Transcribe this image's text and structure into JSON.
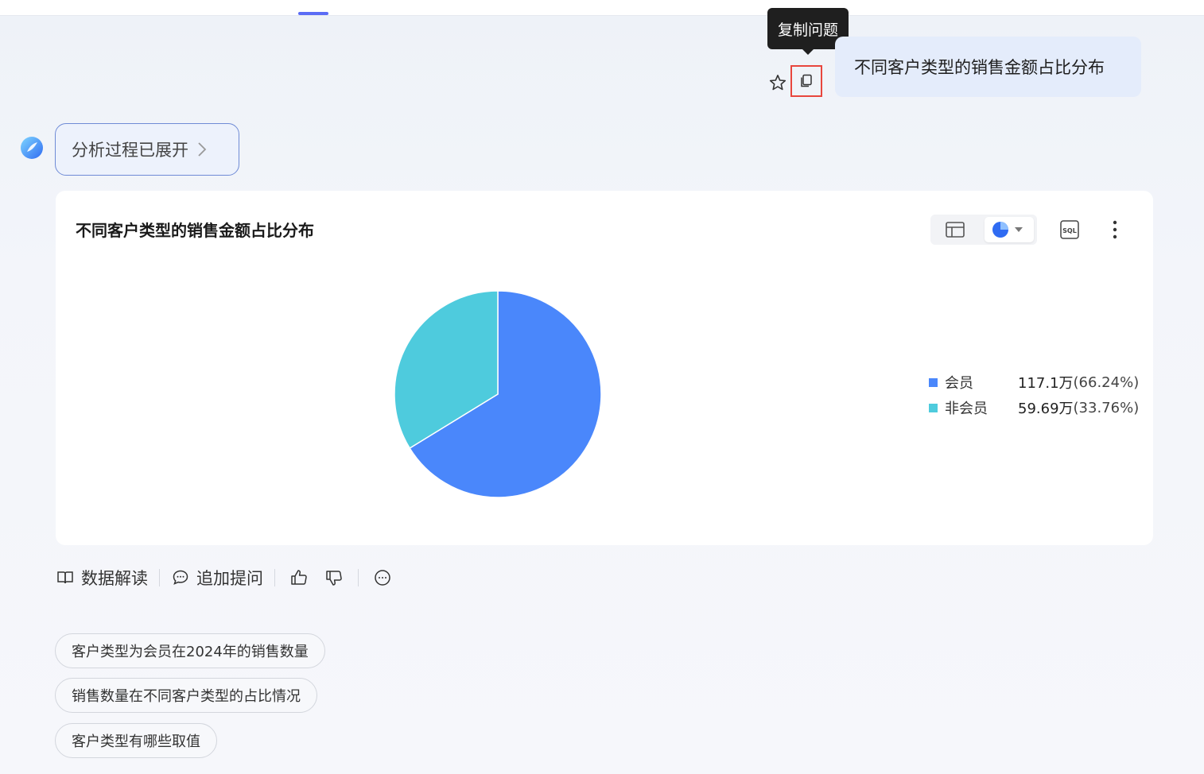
{
  "question": {
    "text": "不同客户类型的销售金额占比分布",
    "copy_tooltip": "复制问题"
  },
  "analysis": {
    "toggle_label": "分析过程已展开"
  },
  "chart_card": {
    "title": "不同客户类型的销售金额占比分布"
  },
  "chart_data": {
    "type": "pie",
    "title": "不同客户类型的销售金额占比分布",
    "slices": [
      {
        "name": "会员",
        "value_label": "117.1万",
        "pct_label": "(66.24%)",
        "pct": 66.24,
        "color": "#4a87fb"
      },
      {
        "name": "非会员",
        "value_label": "59.69万",
        "pct_label": "(33.76%)",
        "pct": 33.76,
        "color": "#4ecbdd"
      }
    ],
    "legend_position": "right"
  },
  "actions": {
    "interpret_label": "数据解读",
    "followup_label": "追加提问"
  },
  "suggestions": [
    "客户类型为会员在2024年的销售数量",
    "销售数量在不同客户类型的占比情况",
    "客户类型有哪些取值"
  ],
  "icons": {
    "star": "star-icon",
    "copy": "copy-icon",
    "table": "table-icon",
    "pie": "pie-chart-icon",
    "sql": "sql-icon",
    "more": "more-vertical-icon",
    "like": "thumbs-up-icon",
    "dislike": "thumbs-down-icon",
    "feedback": "comment-icon"
  },
  "colors": {
    "accent": "#5b6cf5",
    "bubble": "#e4ecfb",
    "highlight": "#e8463d"
  }
}
